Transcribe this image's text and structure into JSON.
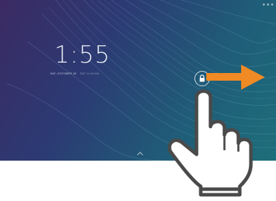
{
  "lockscreen": {
    "time": "1:55",
    "date": "SAT, OCTOBER 26",
    "alarm": "SAT 11:28 AM"
  },
  "icons": {
    "lock": "lock-icon",
    "swipe_arrow": "arrow-right-icon",
    "hand": "pointing-hand-icon",
    "up_chevron": "chevron-up-icon"
  },
  "colors": {
    "arrow": "#f08a24",
    "hand_outline": "#4a4a4a",
    "background_start": "#3b2a63",
    "background_end": "#1e6e7b"
  }
}
